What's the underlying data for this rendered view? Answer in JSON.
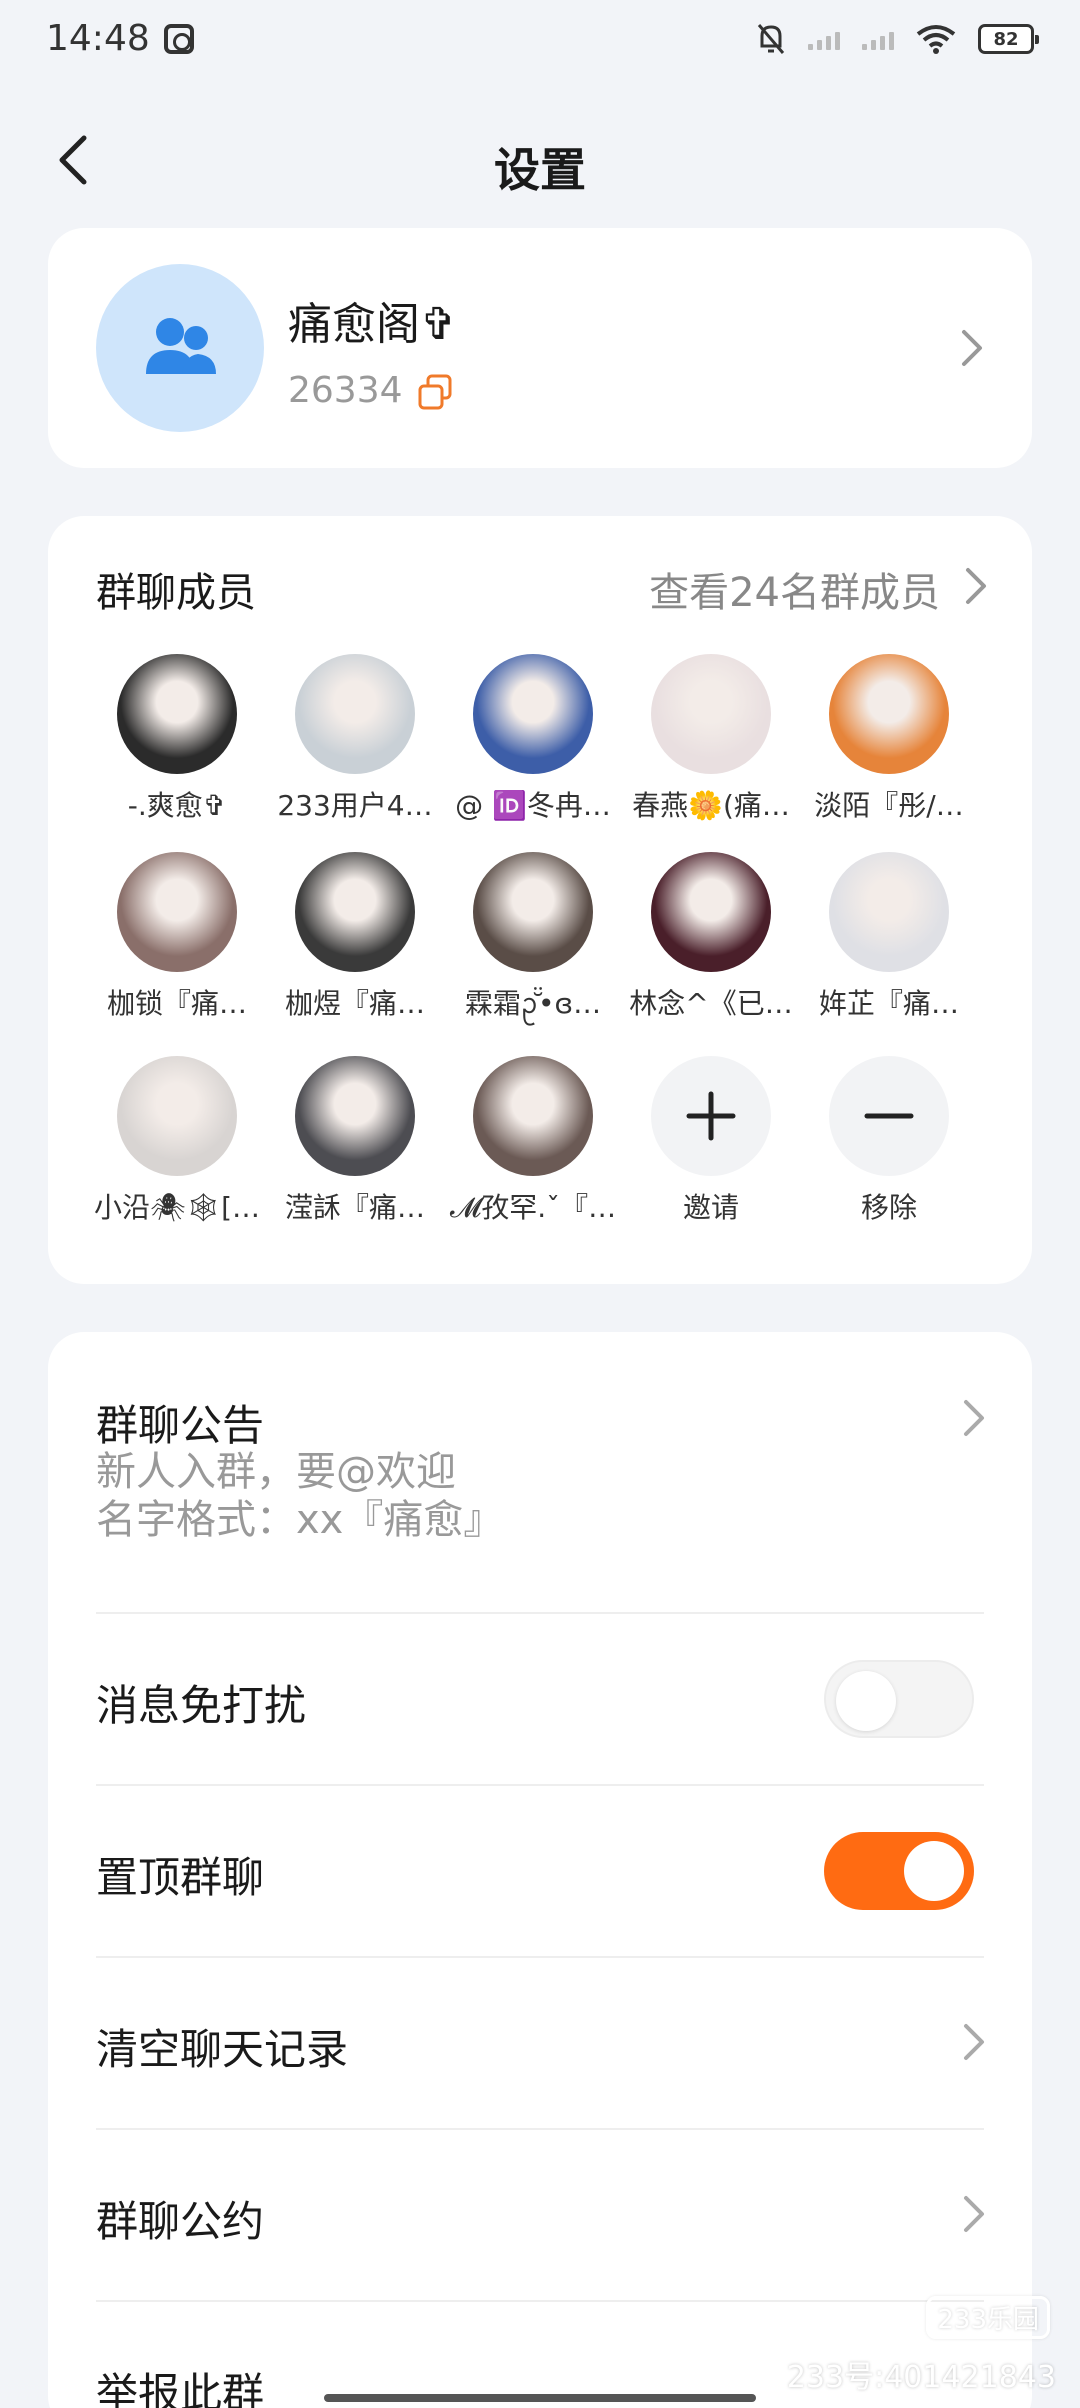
{
  "status_bar": {
    "time": "14:48",
    "battery": "82",
    "icons": [
      "scissors-app-icon",
      "bell-off-icon",
      "signal-icon",
      "signal-icon",
      "wifi-icon",
      "battery-icon"
    ]
  },
  "nav": {
    "back_icon": "chevron-left-icon",
    "title": "设置"
  },
  "group": {
    "name": "痛愈阁✞",
    "id": "26334",
    "avatar_icon": "group-people-icon",
    "copy_icon": "copy-icon"
  },
  "members": {
    "title": "群聊成员",
    "view_all": "查看24名群成员",
    "list": [
      {
        "name": "-.爽愈✞",
        "avatar_color": "#2b2b2b"
      },
      {
        "name": "233用户4…",
        "avatar_color": "#c9d0d6"
      },
      {
        "name": "@ 🆔冬冉…",
        "avatar_color": "#3d5ea8"
      },
      {
        "name": "春燕🌼(痛…",
        "avatar_color": "#e9dfe0"
      },
      {
        "name": "淡陌『彤/…",
        "avatar_color": "#e6843a"
      },
      {
        "name": "枷锁『痛…",
        "avatar_color": "#8a6f6a"
      },
      {
        "name": "枷煜『痛…",
        "avatar_color": "#3a3a3a"
      },
      {
        "name": "霖霜ᩏ̆̈•ɞ…",
        "avatar_color": "#5a4d47"
      },
      {
        "name": "林念^《已…",
        "avatar_color": "#4a1f2a"
      },
      {
        "name": "姩芷『痛…",
        "avatar_color": "#dfe0e5"
      },
      {
        "name": "小沿🕷🕸[…",
        "avatar_color": "#d8d4d2"
      },
      {
        "name": "滢訸『痛…",
        "avatar_color": "#4d4d52"
      },
      {
        "name": "𝓜孜罕.ˇ『…",
        "avatar_color": "#6b5a55"
      }
    ],
    "invite_label": "邀请",
    "remove_label": "移除"
  },
  "settings": {
    "notice_label": "群聊公告",
    "notice_line1": "新人入群，要@欢迎",
    "notice_line2": "名字格式：xx『痛愈』",
    "mute_label": "消息免打扰",
    "mute_on": false,
    "pin_label": "置顶群聊",
    "pin_on": true,
    "clear_label": "清空聊天记录",
    "rules_label": "群聊公约",
    "report_label": "举报此群",
    "accent_color": "#ff6b12"
  },
  "watermark": {
    "logo": "233乐园",
    "text": "233号:401421843"
  }
}
